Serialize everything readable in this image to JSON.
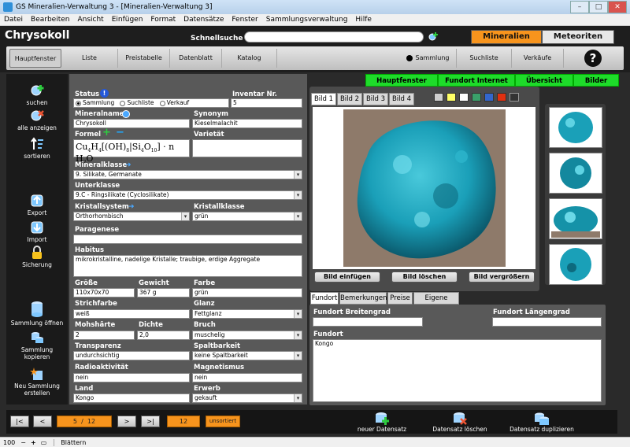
{
  "window": {
    "title": "GS Mineralien-Verwaltung 3 - [Mineralien-Verwaltung 3]"
  },
  "menu": [
    "Datei",
    "Bearbeiten",
    "Ansicht",
    "Einfügen",
    "Format",
    "Datensätze",
    "Fenster",
    "Sammlungsverwaltung",
    "Hilfe"
  ],
  "header": {
    "title": "Chrysokoll",
    "quicksearch_label": "Schnellsuche",
    "quicksearch_value": "",
    "toggle_minerals": "Mineralien",
    "toggle_meteorites": "Meteoriten"
  },
  "nav": {
    "hauptfenster": "Hauptfenster",
    "liste": "Liste",
    "preistabelle": "Preistabelle",
    "datenblatt": "Datenblatt",
    "katalog": "Katalog",
    "sammlung": "Sammlung",
    "suchliste": "Suchliste",
    "verkaeufe": "Verkäufe",
    "help": "?"
  },
  "sidebar": {
    "suchen": "suchen",
    "alle": "alle anzeigen",
    "sortieren": "sortieren",
    "export": "Export",
    "import": "Import",
    "sicherung": "Sicherung",
    "oeffnen": "Sammlung öffnen",
    "kopieren": "Sammlung kopieren",
    "neu": "Neu Sammlung erstellen"
  },
  "form": {
    "status_label": "Status",
    "status_options": [
      "Sammlung",
      "Suchliste",
      "Verkauf"
    ],
    "inventar_label": "Inventar Nr.",
    "inventar": "5",
    "mineralname_label": "Mineralname",
    "mineralname": "Chrysokoll",
    "synonym_label": "Synonym",
    "synonym": "Kieselmalachit",
    "formel_label": "Formel",
    "varietaet_label": "Varietät",
    "varietaet": "",
    "mineralklasse_label": "Mineralklasse",
    "mineralklasse": "9. Silikate, Germanate",
    "unterklasse_label": "Unterklasse",
    "unterklasse": "9.C - Ringsilikate (Cyclosilikate)",
    "kristallsystem_label": "Kristallsystem",
    "kristallsystem": "Orthorhombisch",
    "kristallklasse_label": "Kristallklasse",
    "kristallklasse": "grün",
    "paragenese_label": "Paragenese",
    "paragenese": "",
    "habitus_label": "Habitus",
    "habitus": "mikrokristalline, nadelige Kristalle; traubige, erdige Aggregate",
    "groesse_label": "Größe",
    "groesse": "110x70x70",
    "gewicht_label": "Gewicht",
    "gewicht": "367 g",
    "farbe_label": "Farbe",
    "farbe": "grün",
    "strichfarbe_label": "Strichfarbe",
    "strichfarbe": "weiß",
    "glanz_label": "Glanz",
    "glanz": "Fettglanz",
    "mohs_label": "Mohshärte",
    "mohs": "2",
    "dichte_label": "Dichte",
    "dichte": "2,0",
    "bruch_label": "Bruch",
    "bruch": "muschelig",
    "transparenz_label": "Transparenz",
    "transparenz": "undurchsichtig",
    "spaltbarkeit_label": "Spaltbarkeit",
    "spaltbarkeit": "keine Spaltbarkeit",
    "radio_label": "Radioaktivität",
    "radio": "nein",
    "magnet_label": "Magnetismus",
    "magnet": "nein",
    "land_label": "Land",
    "land": "Kongo",
    "erwerb_label": "Erwerb",
    "erwerb": "gekauft"
  },
  "greentabs": [
    "Hauptfenster",
    "Fundort Internet",
    "Übersicht",
    "Bilder"
  ],
  "imagetabs": [
    "Bild 1",
    "Bild 2",
    "Bild 3",
    "Bild 4"
  ],
  "swatches": [
    "#cfcfcf",
    "#ffff66",
    "#ffffff",
    "#3aa06a",
    "#3366cc",
    "#e03010",
    "#333333"
  ],
  "imgbuttons": {
    "insert": "Bild einfügen",
    "delete": "Bild löschen",
    "enlarge": "Bild vergrößern"
  },
  "lowertabs": [
    "Fundort",
    "Bemerkungen",
    "Preise",
    "Eigene Felder"
  ],
  "fundort": {
    "breite_label": "Fundort Breitengrad",
    "breite": "",
    "laenge_label": "Fundort Längengrad",
    "laenge": "",
    "fundort_label": "Fundort",
    "fundort": "Kongo"
  },
  "pager": {
    "first": "|<",
    "prev": "<",
    "position": "5",
    "sep": "/",
    "total": "12",
    "next": ">",
    "last": ">|",
    "count": "12",
    "sort": "unsortiert"
  },
  "actions": {
    "new": "neuer Datensatz",
    "delete": "Datensatz löschen",
    "duplicate": "Datensatz duplizieren"
  },
  "statusbar": {
    "zoom": "100",
    "mode": "Blättern"
  }
}
